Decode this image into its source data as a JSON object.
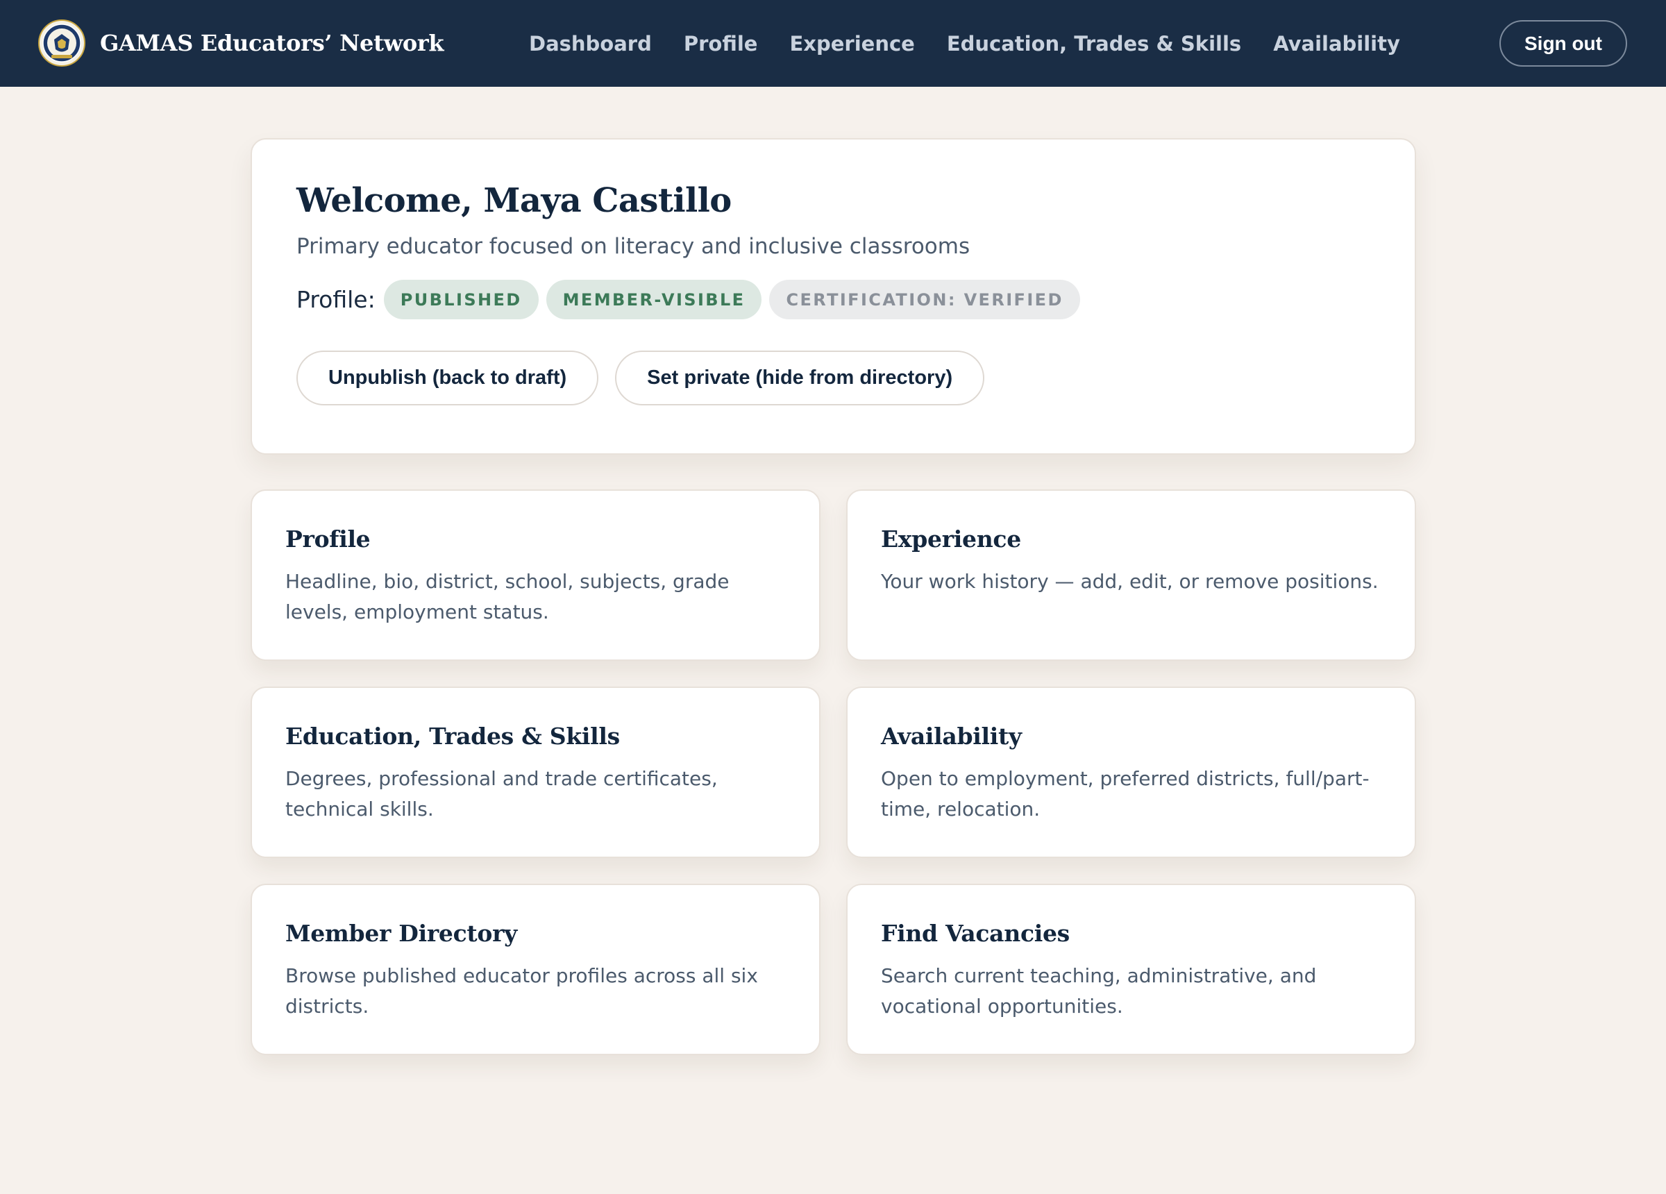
{
  "header": {
    "brand_name": "GAMAS Educators’ Network",
    "nav": [
      {
        "label": "Dashboard"
      },
      {
        "label": "Profile"
      },
      {
        "label": "Experience"
      },
      {
        "label": "Education, Trades & Skills"
      },
      {
        "label": "Availability"
      }
    ],
    "sign_out_label": "Sign out"
  },
  "welcome": {
    "title": "Welcome, Maya Castillo",
    "subtitle": "Primary educator focused on literacy and inclusive classrooms",
    "status_label": "Profile:",
    "badges": [
      {
        "label": "PUBLISHED",
        "tone": "green"
      },
      {
        "label": "MEMBER-VISIBLE",
        "tone": "green"
      },
      {
        "label": "CERTIFICATION: VERIFIED",
        "tone": "grey"
      }
    ],
    "actions": [
      {
        "label": "Unpublish (back to draft)"
      },
      {
        "label": "Set private (hide from directory)"
      }
    ]
  },
  "tiles": [
    {
      "title": "Profile",
      "description": "Headline, bio, district, school, subjects, grade levels, employment status."
    },
    {
      "title": "Experience",
      "description": "Your work history — add, edit, or remove positions."
    },
    {
      "title": "Education, Trades & Skills",
      "description": "Degrees, professional and trade certificates, technical skills."
    },
    {
      "title": "Availability",
      "description": "Open to employment, preferred districts, full/part-time, relocation."
    },
    {
      "title": "Member Directory",
      "description": "Browse published educator profiles across all six districts."
    },
    {
      "title": "Find Vacancies",
      "description": "Search current teaching, administrative, and vocational opportunities."
    }
  ],
  "colors": {
    "topbar": "#1a2d45",
    "page_background": "#f6f1ec",
    "badge_green_bg": "#dde8e2",
    "badge_green_text": "#3c7a58",
    "badge_grey_bg": "#eaebec",
    "badge_grey_text": "#8a9099"
  },
  "icons": {
    "brand_logo": "seal-logo-icon"
  }
}
